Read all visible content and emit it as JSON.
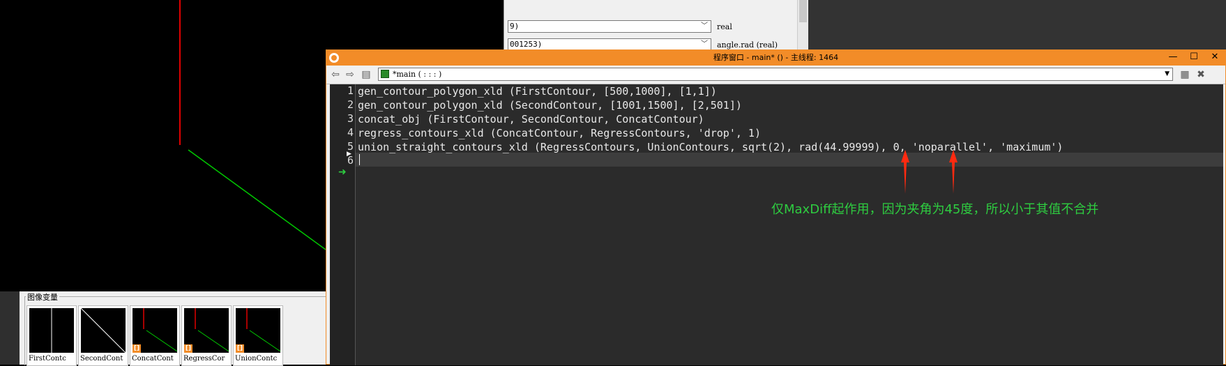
{
  "param_window": {
    "rows": [
      {
        "value": "9)",
        "type": "real"
      },
      {
        "value": "001253)",
        "type": "angle.rad (real)"
      }
    ]
  },
  "variables": {
    "group_label": "图像变量",
    "items": [
      {
        "label": "FirstContc"
      },
      {
        "label": "SecondCont"
      },
      {
        "label": "ConcatCont"
      },
      {
        "label": "RegressCor"
      },
      {
        "label": "UnionContc"
      }
    ],
    "badge_glyph": "[]"
  },
  "program_window": {
    "title": "程序窗口 - main* () - 主线程: 1464",
    "minimize": "—",
    "maximize": "☐",
    "close": "✕",
    "procedure": "*main ( : : : )",
    "line_numbers": [
      "1",
      "2",
      "3",
      "4",
      "5",
      "6"
    ],
    "code_lines": [
      "gen_contour_polygon_xld (FirstContour, [500,1000], [1,1])",
      "gen_contour_polygon_xld (SecondContour, [1001,1500], [2,501])",
      "concat_obj (FirstContour, SecondContour, ConcatContour)",
      "regress_contours_xld (ConcatContour, RegressContours, 'drop', 1)",
      "union_straight_contours_xld (RegressContours, UnionContours, sqrt(2), rad(44.99999), 0, 'noparallel', 'maximum')",
      ""
    ],
    "annotation": "仅MaxDiff起作用，因为夹角为45度，所以小于其值不合并",
    "annotation_color": "#2ecc40",
    "accent_color": "#f28c28"
  },
  "icons": [
    "back-arrow-icon",
    "forward-arrow-icon",
    "insert-icon",
    "procedure-icon",
    "chevron-down-icon",
    "procedure-settings-icon",
    "delete-procedure-icon",
    "program-counter-icon",
    "app-logo-icon"
  ]
}
